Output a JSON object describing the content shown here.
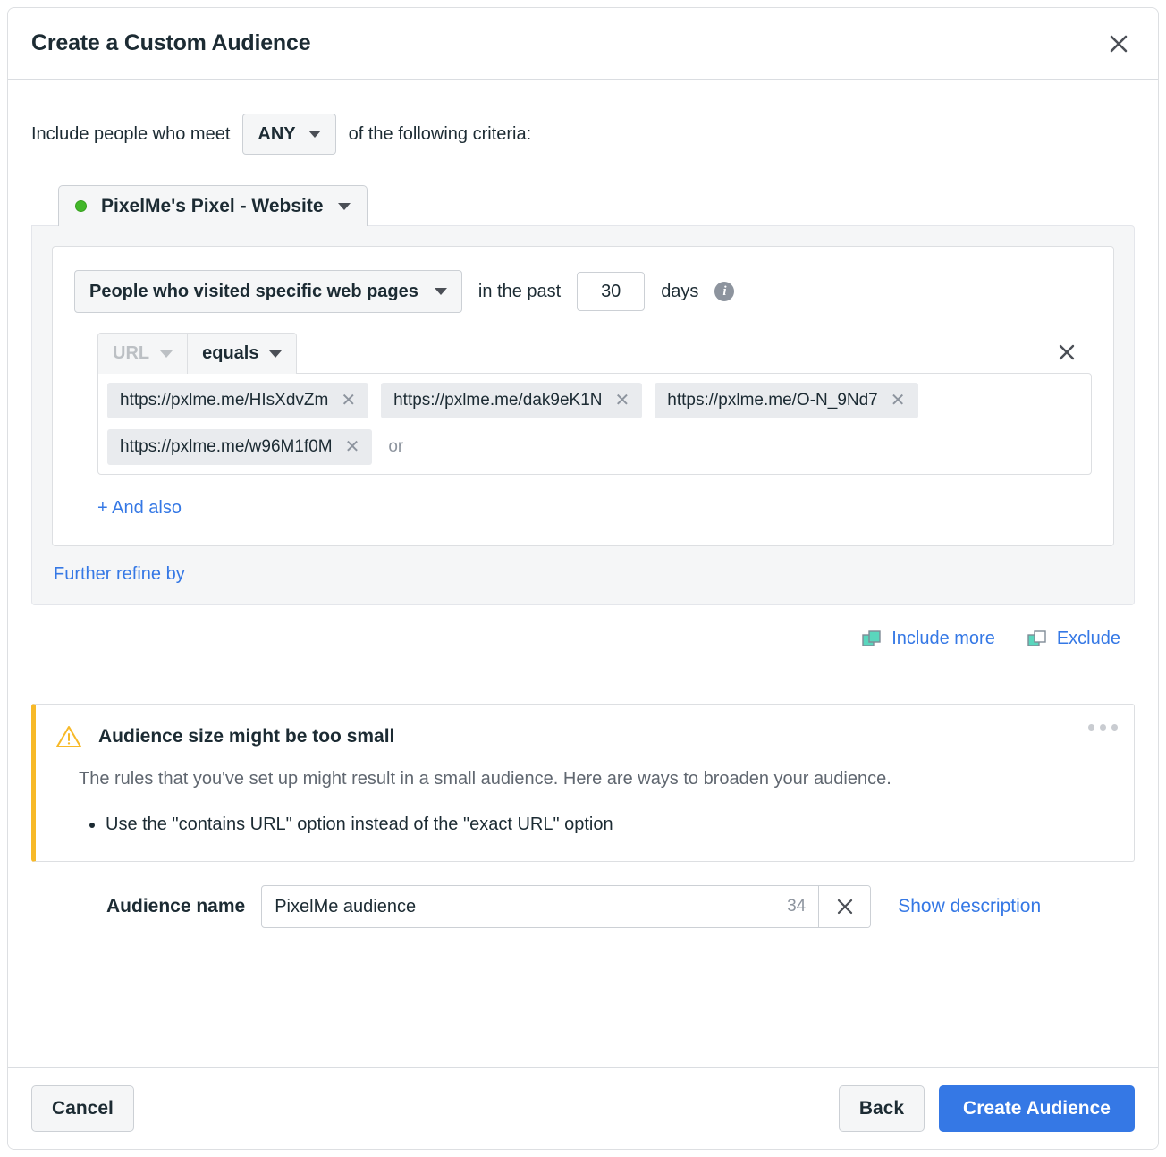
{
  "dialog": {
    "title": "Create a Custom Audience",
    "close_icon": "close-icon"
  },
  "criteria": {
    "include_prefix": "Include people who meet",
    "match_operator": "ANY",
    "include_suffix": "of the following criteria:",
    "source_name": "PixelMe's Pixel - Website",
    "event_rule": "People who visited specific web pages",
    "retention_prefix": "in the past",
    "retention_days": "30",
    "retention_suffix": "days",
    "field": "URL",
    "comparator": "equals",
    "urls": [
      "https://pxlme.me/HIsXdvZm",
      "https://pxlme.me/dak9eK1N",
      "https://pxlme.me/O-N_9Nd7",
      "https://pxlme.me/w96M1f0M"
    ],
    "or_label": "or",
    "and_also_label": "+ And also",
    "further_refine_label": "Further refine by",
    "include_more_label": "Include more",
    "exclude_label": "Exclude"
  },
  "warning": {
    "title": "Audience size might be too small",
    "body": "The rules that you've set up might result in a small audience. Here are ways to broaden your audience.",
    "tips": [
      "Use the \"contains URL\" option instead of the \"exact URL\" option"
    ],
    "icon": "warning-triangle-icon",
    "more_icon": "ellipsis-icon",
    "accent_color": "#f7b928"
  },
  "audience_name": {
    "label": "Audience name",
    "value": "PixelMe audience",
    "placeholder": "Audience name",
    "char_count": "34",
    "clear_icon": "close-icon",
    "show_description_label": "Show description"
  },
  "footer": {
    "cancel_label": "Cancel",
    "back_label": "Back",
    "create_label": "Create Audience",
    "primary_color": "#3578e5"
  },
  "colors": {
    "link": "#3578e5",
    "pixel_status": "#42b72a",
    "include_icon": "#5ad6bd",
    "exclude_icon": "#5ad6bd"
  }
}
